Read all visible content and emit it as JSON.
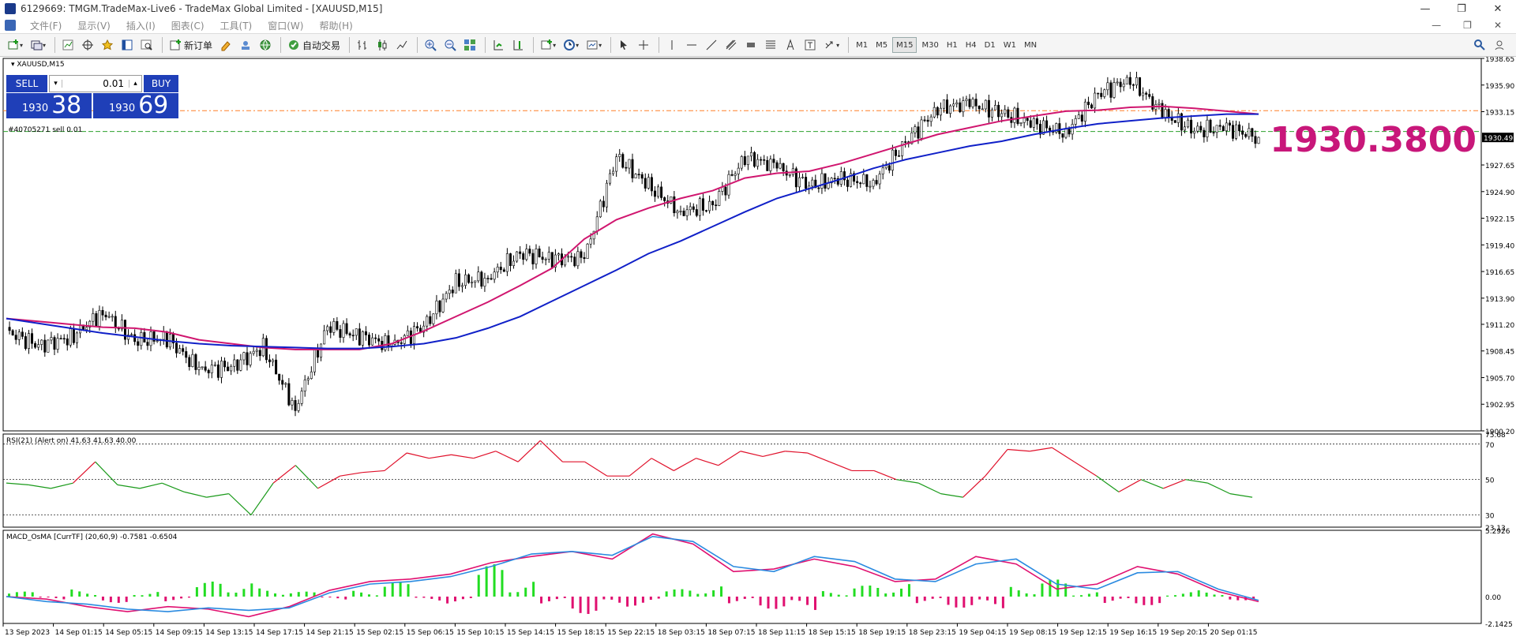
{
  "window": {
    "title": "6129669: TMGM.TradeMax-Live6 - TradeMax Global Limited - [XAUUSD,M15]",
    "controls": [
      "—",
      "❐",
      "✕"
    ]
  },
  "menu": {
    "items": [
      "文件(F)",
      "显示(V)",
      "插入(I)",
      "图表(C)",
      "工具(T)",
      "窗口(W)",
      "帮助(H)"
    ],
    "window_controls": [
      "—",
      "❐",
      "✕"
    ]
  },
  "toolbar": {
    "new_order_label": "新订单",
    "auto_trading_label": "自动交易",
    "timeframes": [
      "M1",
      "M5",
      "M15",
      "M30",
      "H1",
      "H4",
      "D1",
      "W1",
      "MN"
    ],
    "active_timeframe": "M15"
  },
  "chart": {
    "symbol_label": "XAUUSD,M15",
    "order_label": "#40705271 sell 0.01",
    "big_price": "1930.3800",
    "current_price_tag": "1930.49",
    "trade_panel": {
      "sell_label": "SELL",
      "buy_label": "BUY",
      "lot": "0.01",
      "sell_small": "1930",
      "sell_big": "38",
      "buy_small": "1930",
      "buy_big": "69"
    },
    "colors": {
      "candle": "#000000",
      "ma_fast": "#d0166f",
      "ma_slow": "#1020c8",
      "orange_line": "#ff7f27",
      "green_line": "#2ca02c",
      "big_price": "#c8177a"
    }
  },
  "chart_data": [
    {
      "type": "line",
      "title": "XAUUSD,M15",
      "ylim": [
        1900.2,
        1938.65
      ],
      "y_ticks": [
        "1938.65",
        "1935.90",
        "1933.15",
        "1930.49",
        "1927.65",
        "1924.90",
        "1922.15",
        "1919.40",
        "1916.65",
        "1913.90",
        "1911.20",
        "1908.45",
        "1905.70",
        "1902.95",
        "1900.20"
      ],
      "x_labels": [
        "13 Sep 2023",
        "14 Sep 01:15",
        "14 Sep 05:15",
        "14 Sep 09:15",
        "14 Sep 13:15",
        "14 Sep 17:15",
        "14 Sep 21:15",
        "15 Sep 02:15",
        "15 Sep 06:15",
        "15 Sep 10:15",
        "15 Sep 14:15",
        "15 Sep 18:15",
        "15 Sep 22:15",
        "18 Sep 03:15",
        "18 Sep 07:15",
        "18 Sep 11:15",
        "18 Sep 15:15",
        "18 Sep 19:15",
        "18 Sep 23:15",
        "19 Sep 04:15",
        "19 Sep 08:15",
        "19 Sep 12:15",
        "19 Sep 16:15",
        "19 Sep 20:15",
        "20 Sep 01:15"
      ],
      "close": [
        1910.5,
        1909.0,
        1909.8,
        1912.5,
        1909.5,
        1909.8,
        1906.5,
        1906.8,
        1908.8,
        1902.5,
        1911.0,
        1910.0,
        1909.0,
        1911.0,
        1915.5,
        1916.0,
        1918.5,
        1918.0,
        1918.0,
        1928.5,
        1925.5,
        1922.8,
        1923.5,
        1928.5,
        1927.5,
        1925.5,
        1926.2,
        1925.8,
        1930.0,
        1933.5,
        1934.0,
        1933.0,
        1931.8,
        1931.0,
        1935.0,
        1936.5,
        1933.0,
        1931.2,
        1931.5,
        1930.5
      ],
      "series": [
        {
          "values": [
            1911.8,
            1911.5,
            1911.2,
            1910.9,
            1910.8,
            1910.4,
            1909.6,
            1909.2,
            1908.8,
            1908.6,
            1908.6,
            1908.6,
            1909.2,
            1910.5,
            1912.0,
            1913.5,
            1915.2,
            1917.0,
            1920.0,
            1922.0,
            1923.2,
            1924.2,
            1925.0,
            1926.3,
            1926.8,
            1927.0,
            1927.8,
            1928.8,
            1929.8,
            1930.8,
            1931.5,
            1932.2,
            1932.7,
            1933.2,
            1933.3,
            1933.6,
            1933.7,
            1933.5,
            1933.2,
            1932.9
          ]
        },
        {
          "values": [
            1911.8,
            1911.3,
            1910.8,
            1910.3,
            1909.9,
            1909.5,
            1909.2,
            1909.0,
            1908.9,
            1908.8,
            1908.7,
            1908.7,
            1908.9,
            1909.2,
            1909.8,
            1910.8,
            1912.0,
            1913.6,
            1915.2,
            1916.8,
            1918.5,
            1919.8,
            1921.3,
            1922.8,
            1924.2,
            1925.2,
            1926.2,
            1927.3,
            1928.2,
            1928.9,
            1929.6,
            1930.1,
            1930.8,
            1931.4,
            1931.9,
            1932.2,
            1932.5,
            1932.7,
            1932.9,
            1932.9
          ]
        }
      ],
      "levels": [
        1933.25,
        1931.1
      ]
    },
    {
      "type": "line",
      "title": "RSI(21) (Alert on) 41.63 41.63 40.00",
      "ylim": [
        23.13,
        75.68
      ],
      "y_ticks": [
        "75.68",
        "70",
        "50",
        "30",
        "23.13"
      ],
      "values": [
        48,
        47,
        45,
        48,
        60,
        47,
        45,
        48,
        43,
        40,
        42,
        30,
        48,
        58,
        45,
        52,
        54,
        55,
        65,
        62,
        64,
        62,
        66,
        60,
        72,
        60,
        60,
        52,
        52,
        62,
        55,
        62,
        58,
        66,
        63,
        66,
        65,
        60,
        55,
        55,
        50,
        48,
        42,
        40,
        52,
        67,
        66,
        68,
        60,
        52,
        43,
        50,
        45,
        50,
        48,
        42,
        40
      ]
    },
    {
      "type": "bar",
      "title": "MACD_OsMA [CurrTF] (20,60,9) -0.7581 -0.6504",
      "ylim": [
        -2.1425,
        5.2926
      ],
      "y_ticks": [
        "5.2926",
        "0.00",
        "-2.1425"
      ],
      "macd": [
        0.0,
        -0.2,
        -0.8,
        -1.2,
        -0.8,
        -1.0,
        -1.6,
        -0.8,
        0.5,
        1.2,
        1.4,
        1.8,
        2.7,
        3.2,
        3.6,
        3.0,
        5.0,
        4.2,
        2.0,
        2.2,
        3.0,
        2.4,
        1.2,
        1.4,
        3.2,
        2.6,
        0.6,
        1.0,
        2.4,
        1.8,
        0.4,
        -0.4
      ],
      "signal": [
        0.0,
        -0.4,
        -0.6,
        -1.0,
        -1.2,
        -0.9,
        -1.1,
        -0.9,
        0.3,
        1.0,
        1.2,
        1.6,
        2.4,
        3.4,
        3.6,
        3.3,
        4.8,
        4.4,
        2.4,
        2.0,
        3.2,
        2.8,
        1.4,
        1.2,
        2.6,
        3.0,
        1.0,
        0.6,
        1.9,
        2.0,
        0.6,
        -0.3
      ],
      "histogram": [
        0.4,
        -0.3,
        0.6,
        -0.5,
        0.5,
        -0.4,
        1.2,
        1.4,
        0.7,
        0.4,
        -0.3,
        0.5,
        1.2,
        -0.4,
        -0.6,
        2.6,
        1.5,
        -0.6,
        -1.4,
        -1.0,
        -0.8,
        0.6,
        1.0,
        -0.6,
        -1.0,
        -1.3,
        0.5,
        0.9,
        1.2,
        -0.6,
        -0.9,
        -1.1,
        0.9,
        1.4,
        0.4,
        -0.6,
        -0.7,
        0.4,
        0.6,
        -0.3
      ]
    }
  ]
}
